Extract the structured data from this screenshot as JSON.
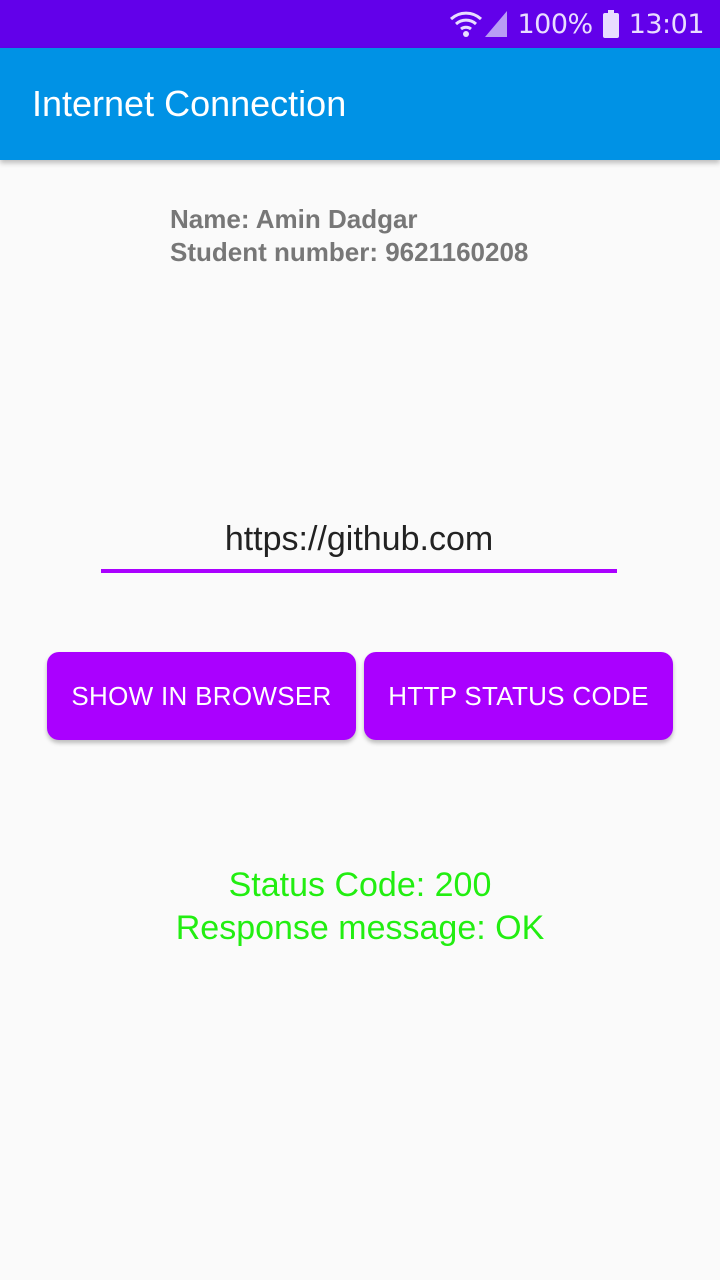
{
  "status_bar": {
    "battery_level": "100%",
    "time": "13:01",
    "icons": [
      "wifi-icon",
      "signal-icon",
      "battery-icon"
    ]
  },
  "app_bar": {
    "title": "Internet Connection"
  },
  "info": {
    "name_line": "Name: Amin Dadgar",
    "student_line": "Student number: 9621160208"
  },
  "url_input": {
    "value": "https://github.com"
  },
  "buttons": {
    "show_in_browser": "SHOW IN BROWSER",
    "http_status_code": "HTTP STATUS CODE"
  },
  "result": {
    "status_code_line": "Status Code: 200",
    "response_message_line": "Response message: OK"
  },
  "colors": {
    "status_bar": "#6200ea",
    "app_bar": "#0092e5",
    "accent": "#aa00ff",
    "result_text": "#22ee11"
  }
}
